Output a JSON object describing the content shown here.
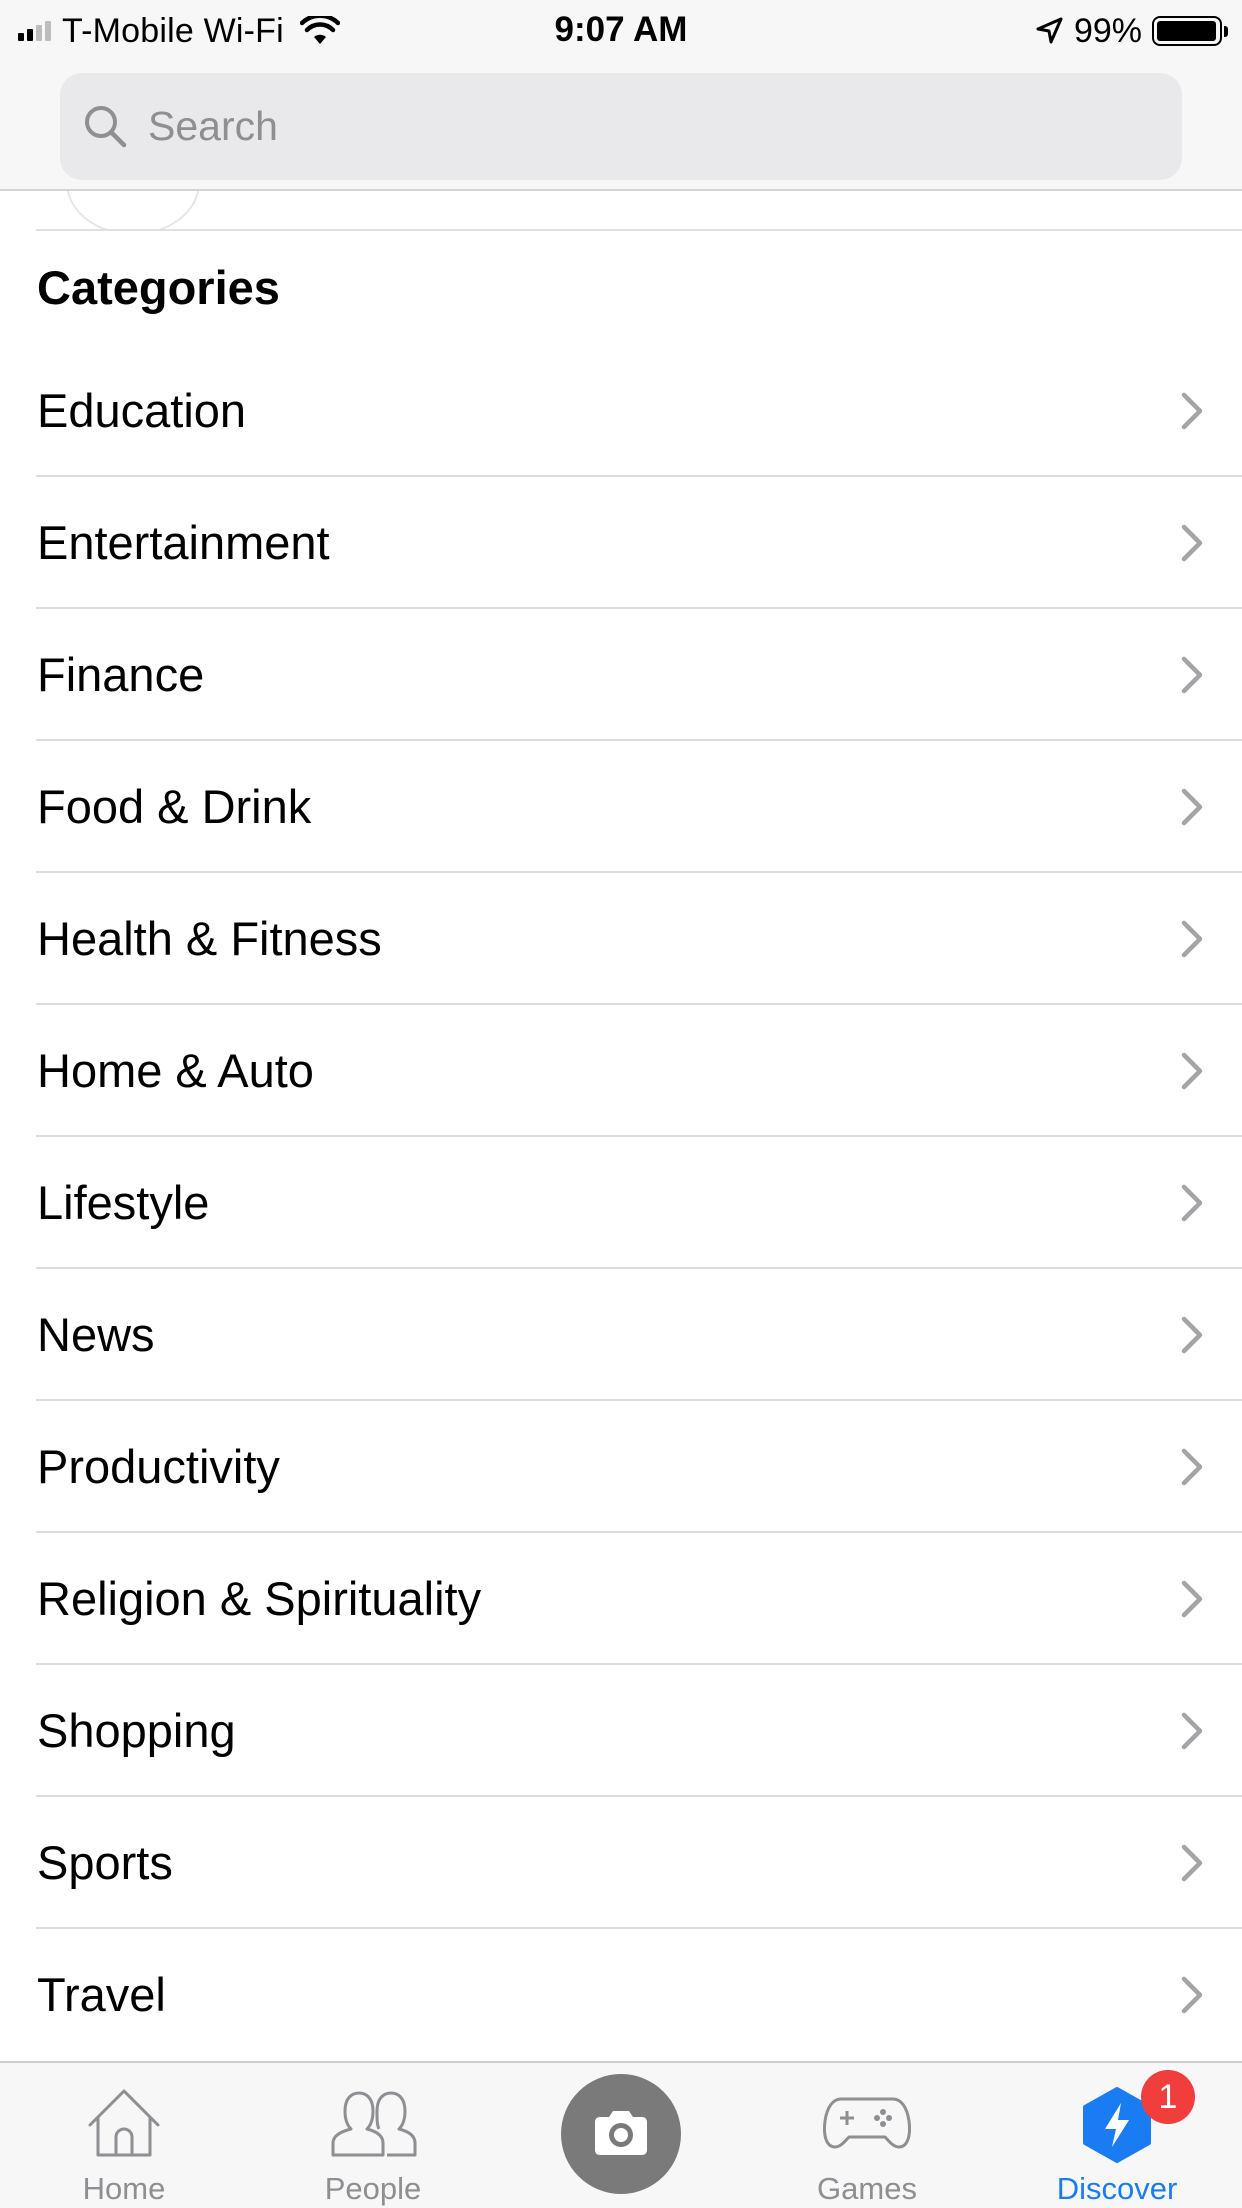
{
  "status_bar": {
    "carrier": "T-Mobile Wi-Fi",
    "time": "9:07 AM",
    "battery_percent": "99%",
    "battery_level": 0.99
  },
  "search": {
    "placeholder": "Search",
    "value": ""
  },
  "categories": {
    "title": "Categories",
    "items": [
      {
        "label": "Education"
      },
      {
        "label": "Entertainment"
      },
      {
        "label": "Finance"
      },
      {
        "label": "Food & Drink"
      },
      {
        "label": "Health & Fitness"
      },
      {
        "label": "Home & Auto"
      },
      {
        "label": "Lifestyle"
      },
      {
        "label": "News"
      },
      {
        "label": "Productivity"
      },
      {
        "label": "Religion & Spirituality"
      },
      {
        "label": "Shopping"
      },
      {
        "label": "Sports"
      },
      {
        "label": "Travel"
      }
    ]
  },
  "tab_bar": {
    "home_label": "Home",
    "people_label": "People",
    "games_label": "Games",
    "discover_label": "Discover",
    "discover_badge": "1",
    "active_tab": "Discover"
  },
  "colors": {
    "accent": "#1a7cf2",
    "badge": "#f23d3d",
    "inactive": "#8e8e93"
  }
}
